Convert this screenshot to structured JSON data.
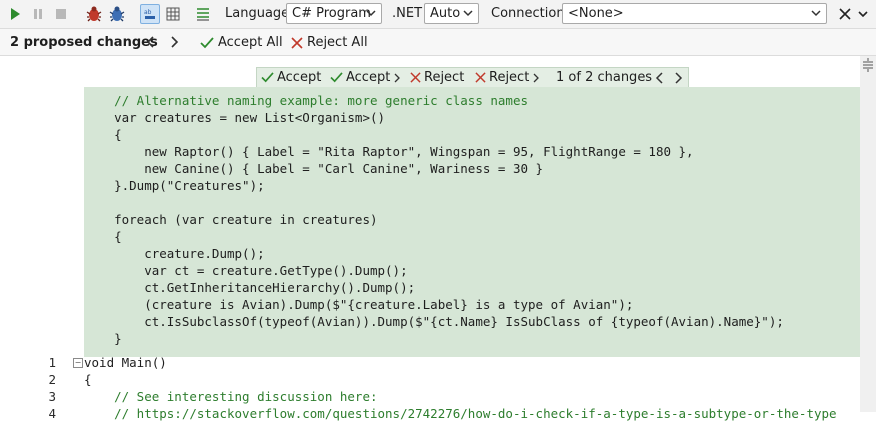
{
  "toolbar": {
    "language_label": "Language",
    "language_value": "C# Program",
    "net_label": ".NET",
    "net_value": "Auto",
    "connection_label": "Connection",
    "connection_value": "<None>",
    "icons": [
      "run-icon",
      "pause-icon",
      "stop-icon",
      "debug-bug-icon",
      "debug-bug-alt-icon",
      "text-results-icon",
      "grid-results-icon",
      "outline-icon",
      "close-icon",
      "collapse-icon"
    ]
  },
  "proposals": {
    "count_label": "2 proposed changes",
    "accept_all": "Accept All",
    "reject_all": "Reject All"
  },
  "inline_bar": {
    "accept": "Accept",
    "accept_next": "Accept",
    "reject": "Reject",
    "reject_next": "Reject",
    "counter": "1 of 2 changes"
  },
  "proposal_code": [
    "    // Alternative naming example: more generic class names",
    "    var creatures = new List<Organism>()",
    "    {",
    "        new Raptor() { Label = \"Rita Raptor\", Wingspan = 95, FlightRange = 180 },",
    "        new Canine() { Label = \"Carl Canine\", Wariness = 30 }",
    "    }.Dump(\"Creatures\");",
    "",
    "    foreach (var creature in creatures)",
    "    {",
    "        creature.Dump();",
    "        var ct = creature.GetType().Dump();",
    "        ct.GetInheritanceHierarchy().Dump();",
    "        (creature is Avian).Dump($\"{creature.Label} is a type of Avian\");",
    "        ct.IsSubclassOf(typeof(Avian)).Dump($\"{ct.Name} IsSubClass of {typeof(Avian).Name}\");",
    "    }"
  ],
  "editor_lines": [
    {
      "no": "1",
      "text": "void Main()"
    },
    {
      "no": "2",
      "text": "{"
    },
    {
      "no": "3",
      "text": "    // See interesting discussion here:"
    },
    {
      "no": "4",
      "text": "    // https://stackoverflow.com/questions/2742276/how-do-i-check-if-a-type-is-a-subtype-or-the-type"
    }
  ],
  "colors": {
    "proposal_bg": "#d6e6d6",
    "accept_green": "#2e8b2e",
    "reject_red": "#c0392b",
    "comment_green": "#2d7d2d"
  }
}
